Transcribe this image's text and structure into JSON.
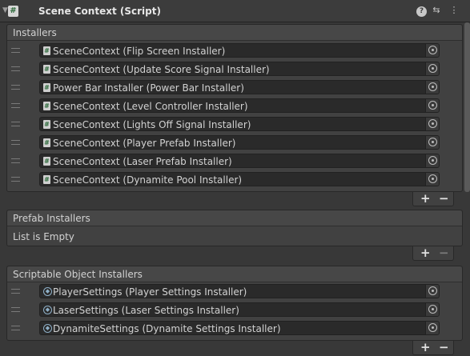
{
  "component": {
    "title": "Scene Context (Script)",
    "script_icon": "#",
    "icons": {
      "help": "help-icon",
      "presets": "presets-icon",
      "menu": "kebab-menu-icon"
    }
  },
  "installers": {
    "header": "Installers",
    "items": [
      {
        "label": "SceneContext (Flip Screen Installer)"
      },
      {
        "label": "SceneContext (Update Score Signal Installer)"
      },
      {
        "label": "Power Bar Installer (Power Bar Installer)"
      },
      {
        "label": "SceneContext (Level Controller Installer)"
      },
      {
        "label": "SceneContext (Lights Off Signal Installer)"
      },
      {
        "label": "SceneContext (Player Prefab Installer)"
      },
      {
        "label": "SceneContext (Laser Prefab Installer)"
      },
      {
        "label": "SceneContext (Dynamite Pool Installer)"
      }
    ],
    "add": "+",
    "remove": "−"
  },
  "prefab_installers": {
    "header": "Prefab Installers",
    "empty_text": "List is Empty",
    "add": "+",
    "remove": "−"
  },
  "scriptable_installers": {
    "header": "Scriptable Object Installers",
    "items": [
      {
        "label": "PlayerSettings (Player Settings Installer)"
      },
      {
        "label": "LaserSettings (Laser Settings Installer)"
      },
      {
        "label": "DynamiteSettings (Dynamite Settings Installer)"
      }
    ],
    "add": "+",
    "remove": "−"
  }
}
